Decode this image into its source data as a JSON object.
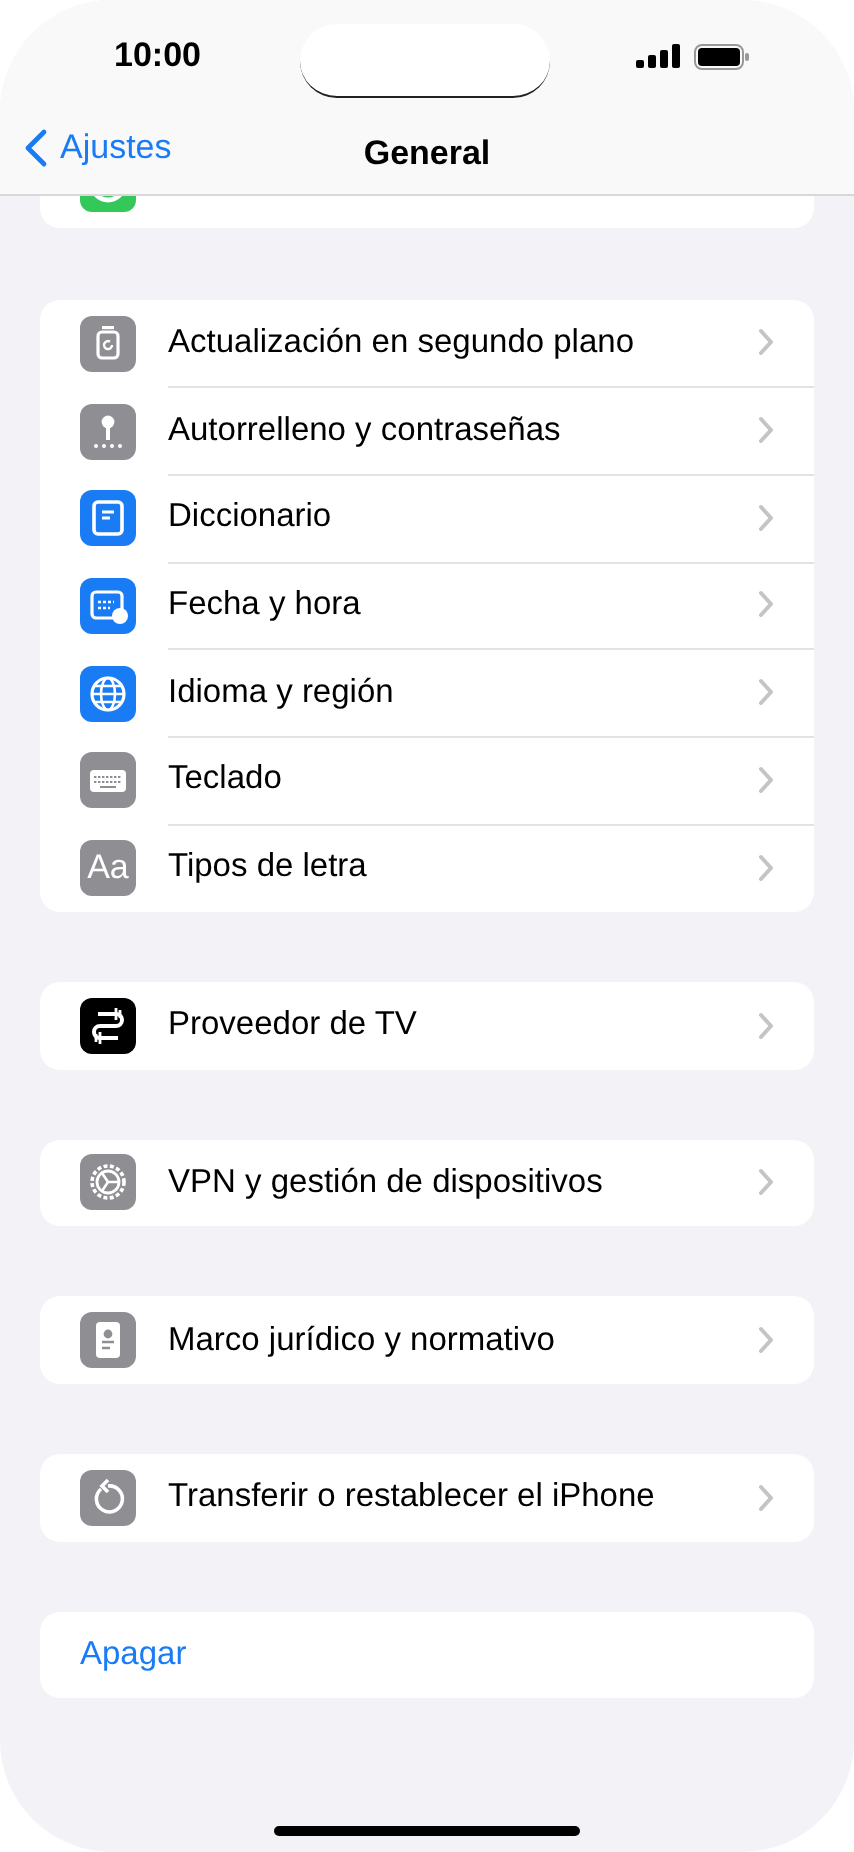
{
  "status_bar": {
    "time": "10:00"
  },
  "nav": {
    "back": "Ajustes",
    "title": "General"
  },
  "top_row": {
    "kind": "green"
  },
  "groups": [
    {
      "rows": [
        {
          "kind": "bgrefresh",
          "label": "Actualización en segundo plano"
        },
        {
          "kind": "key",
          "label": "Autorrelleno y contraseñas"
        },
        {
          "kind": "book",
          "label": "Diccionario"
        },
        {
          "kind": "calendar",
          "label": "Fecha y hora"
        },
        {
          "kind": "globe",
          "label": "Idioma y región"
        },
        {
          "kind": "keyboard",
          "label": "Teclado"
        },
        {
          "kind": "font",
          "label": "Tipos de letra",
          "icon_text": "Aa"
        }
      ]
    },
    {
      "rows": [
        {
          "kind": "tv",
          "label": "Proveedor de TV"
        }
      ]
    },
    {
      "rows": [
        {
          "kind": "gear",
          "label": "VPN y gestión de dispositivos"
        }
      ]
    },
    {
      "rows": [
        {
          "kind": "legal",
          "label": "Marco jurídico y normativo"
        }
      ]
    },
    {
      "rows": [
        {
          "kind": "reset",
          "label": "Transferir o restablecer el iPhone"
        }
      ]
    },
    {
      "rows": [
        {
          "kind": "action",
          "label": "Apagar"
        }
      ]
    }
  ]
}
